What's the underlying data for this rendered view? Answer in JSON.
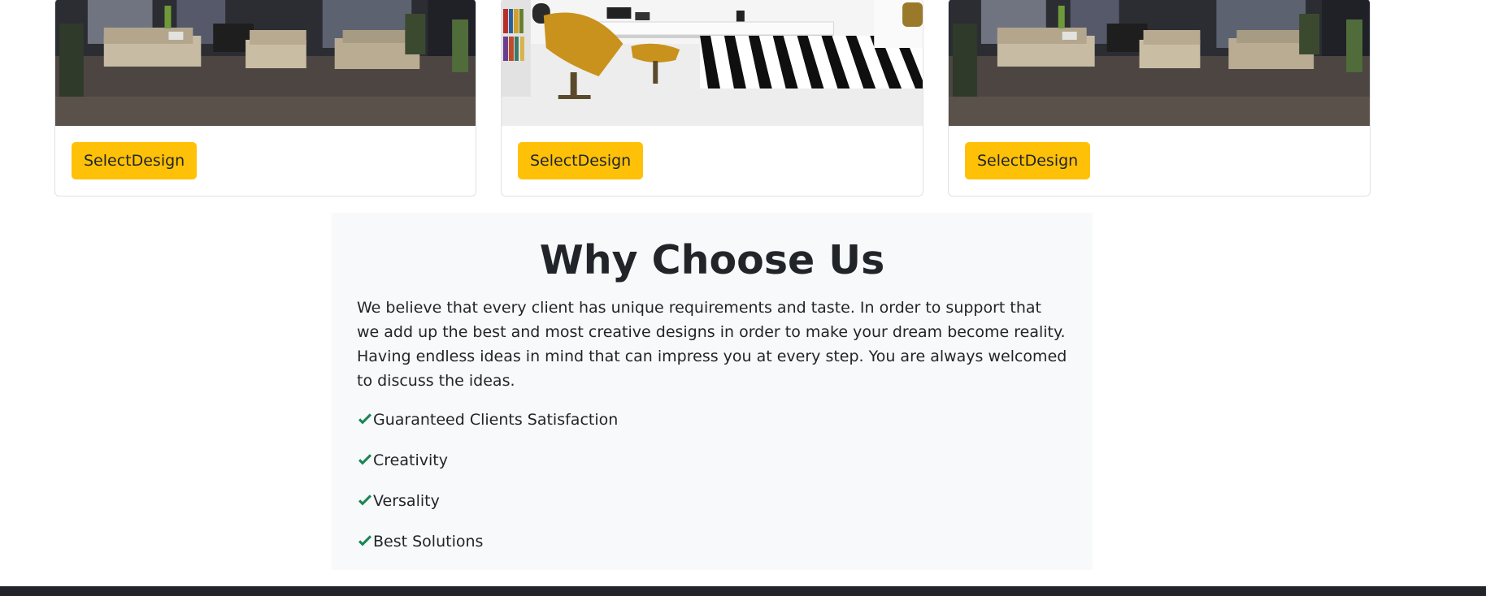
{
  "designs": [
    {
      "button_label": "SelectDesign",
      "image": "living-room-dark-photo"
    },
    {
      "button_label": "SelectDesign",
      "image": "living-room-white-photo"
    },
    {
      "button_label": "SelectDesign",
      "image": "living-room-dark-photo"
    }
  ],
  "why": {
    "title": "Why Choose Us",
    "description": "We believe that every client has unique requirements and taste. In order to support that we add up the best and most creative designs in order to make your dream become reality. Having endless ideas in mind that can impress you at every step. You are always welcomed to discuss the ideas.",
    "features": [
      "Guaranteed Clients Satisfaction",
      "Creativity",
      "Versality",
      "Best Solutions"
    ],
    "check_icon": "check-icon"
  },
  "colors": {
    "accent": "#ffc107",
    "check": "#198754",
    "section_bg": "#f8f9fa",
    "footer": "#212529"
  }
}
